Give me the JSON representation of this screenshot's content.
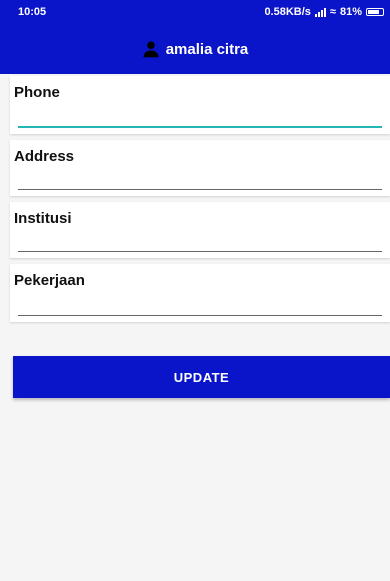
{
  "status_bar": {
    "time": "10:05",
    "net_speed": "0.58KB/s",
    "battery": "81%",
    "battery_level": 0.81
  },
  "app_bar": {
    "title": "amalia citra",
    "icon": "person-icon"
  },
  "form": {
    "fields": [
      {
        "label": "Phone",
        "value": "",
        "active": true
      },
      {
        "label": "Address",
        "value": "",
        "active": false
      },
      {
        "label": "Institusi",
        "value": "",
        "active": false
      },
      {
        "label": "Pekerjaan",
        "value": "",
        "active": false
      }
    ],
    "update_label": "UPDATE"
  },
  "colors": {
    "primary": "#0a14c8",
    "accent": "#26b5b5",
    "background": "#f5f5f5"
  }
}
